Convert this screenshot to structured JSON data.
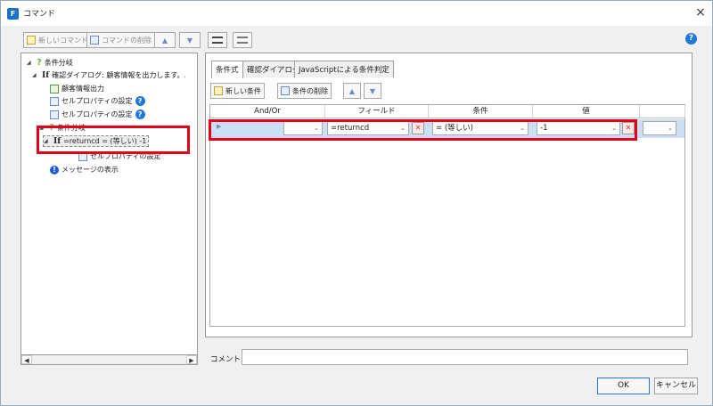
{
  "window": {
    "title": "コマンド",
    "close_glyph": "×"
  },
  "toolbar": {
    "new_command": "新しいコマンド",
    "delete_command": "コマンドの削除",
    "up_glyph": "▲",
    "down_glyph": "▼",
    "help_glyph": "?"
  },
  "tree": {
    "items": [
      {
        "label": "条件分岐",
        "prefix": "?"
      },
      {
        "label": "確認ダイアログ: 顧客情報を出力します。よろ",
        "prefix": "If"
      },
      {
        "label": "顧客情報出力"
      },
      {
        "label": "セルプロパティの設定"
      },
      {
        "label": "セルプロパティの設定"
      },
      {
        "label": "条件分岐",
        "prefix": "?"
      },
      {
        "label": "=returncd = (等しい) -1",
        "prefix": "If"
      },
      {
        "label": "セルプロパティの設定"
      },
      {
        "label": "メッセージの表示"
      }
    ]
  },
  "tabs": [
    {
      "label": "条件式",
      "active": true
    },
    {
      "label": "確認ダイアログ"
    },
    {
      "label": "JavaScriptによる条件判定"
    }
  ],
  "condition_toolbar": {
    "new_condition": "新しい条件",
    "delete_condition": "条件の削除"
  },
  "grid": {
    "headers": [
      "And/Or",
      "フィールド",
      "条件",
      "値"
    ],
    "row": {
      "andor": "",
      "field": "=returncd",
      "condition": "= (等しい)",
      "value": "-1",
      "extra": ""
    }
  },
  "comment": {
    "label": "コメント",
    "value": ""
  },
  "buttons": {
    "ok": "OK",
    "cancel": "キャンセル"
  },
  "colors": {
    "accent": "#1e78d7",
    "highlight": "#e3001b",
    "selected_row": "#cce0f5"
  }
}
